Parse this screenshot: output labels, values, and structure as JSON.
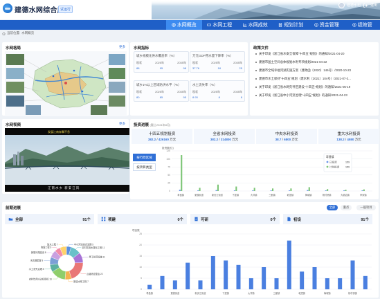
{
  "header": {
    "title": "建德水网综合应用",
    "trial_tag": "试运行",
    "user_name": "建德水利",
    "logout": "退出"
  },
  "nav": {
    "items": [
      {
        "label": "水网概览",
        "icon": "globe-icon",
        "active": true
      },
      {
        "label": "水网工程",
        "icon": "pipe-icon",
        "active": false
      },
      {
        "label": "水网成效",
        "icon": "chart-icon",
        "active": false
      },
      {
        "label": "规划计划",
        "icon": "doc-icon",
        "active": false
      },
      {
        "label": "资金管理",
        "icon": "money-icon",
        "active": false
      },
      {
        "label": "绩效管",
        "icon": "target-icon",
        "active": false
      }
    ]
  },
  "breadcrumb": {
    "prefix": "当前位置:",
    "current": "水网概览"
  },
  "water_map": {
    "title": "水网格局",
    "more": "更多"
  },
  "indicators": {
    "title": "水网指标",
    "cards": [
      {
        "name": "城乡规模化供水覆盖率（%）",
        "cols": [
          "现状",
          "2025年",
          "2035年"
        ],
        "vals": [
          "88",
          "95",
          "98"
        ]
      },
      {
        "name": "万元GDP用水量下降率（%）",
        "cols": [
          "现状",
          "2025年",
          "2035年"
        ],
        "vals": [
          "37.76",
          "18",
          "25"
        ]
      },
      {
        "name": "城乡1%以上区域防洪水平（%）",
        "cols": [
          "现状",
          "2025年",
          "2035年"
        ],
        "vals": [
          "80",
          "85",
          "95"
        ]
      },
      {
        "name": "水土流失率（%）",
        "cols": [
          "现状",
          "2025年",
          "2035年"
        ],
        "vals": [
          "8.93",
          "8",
          "8"
        ]
      }
    ]
  },
  "policy": {
    "title": "政策文件",
    "items": [
      "关于印发《浙江省水安全保障\"十四五\"规划》的通知/2021-04-20",
      "建德市国土空间总体规划水利专项规划/2021-04-22",
      "建德市全域幸福河湖实施方案（建政函〔2020〕146号）/2020-10-23",
      "建德市水土保持\"十四五\"规划（建水利〔2021〕104号）/2021-07-2...",
      "关于印发《浙江省水网先导区建设\"十四五\"规划》的通知/2021-05-19",
      "关于印发《浙江省中小河流治理\"十四五\"规划》的通知/2021-04-23"
    ]
  },
  "video": {
    "title": "水网视频",
    "more": "更多",
    "caption": "发展江南奔腾不息",
    "subtitle": "江南水乡 新安江风"
  },
  "investment": {
    "title": "投资进展",
    "note": "(截止2021年8月)",
    "cards": [
      {
        "name": "十四五规划投资",
        "done": "382.2",
        "total": "426160",
        "unit": "万元"
      },
      {
        "name": "全省水网投资",
        "done": "382.2",
        "total": "314800",
        "unit": "万元"
      },
      {
        "name": "中央水利投资",
        "done": "38.7",
        "total": "6800",
        "unit": "万元"
      },
      {
        "name": "重大水利投资",
        "done": "138.2",
        "total": "4580",
        "unit": "万元"
      }
    ],
    "buttons": [
      "按行政区域",
      "按项目类型"
    ]
  },
  "chart_data": [
    {
      "type": "bar",
      "ylabel": "投资额(亿)",
      "ylim": [
        0,
        125
      ],
      "yticks": [
        0,
        25,
        50,
        75,
        100,
        125
      ],
      "categories": [
        "寿昌镇",
        "更楼街道",
        "新安江街道",
        "下涯镇",
        "大洋镇",
        "三都镇",
        "乾潭镇",
        "梅城镇",
        "杨村桥镇",
        "大慈岩镇",
        "李家镇"
      ],
      "series": [
        {
          "name": "已投资",
          "color": "#6b95e8",
          "values": [
            4,
            2,
            3,
            2,
            2,
            2,
            2,
            3,
            2,
            2,
            2
          ]
        },
        {
          "name": "计划投资",
          "color": "#7cc576",
          "values": [
            112,
            10,
            20,
            14,
            10,
            8,
            8,
            12,
            6,
            4,
            5
          ]
        }
      ],
      "legend": {
        "title": "寿昌镇",
        "entries": [
          {
            "name": "已投资",
            "value": "159"
          },
          {
            "name": "计划投资",
            "value": "159"
          }
        ]
      }
    },
    {
      "type": "pie",
      "slices": [
        {
          "label": "中小河流综合治理",
          "value": 5,
          "color": "#5b8fe0"
        },
        {
          "label": "农村饮用水提标工程",
          "value": 11,
          "color": "#69c0c9"
        },
        {
          "label": "骨干排涝设施",
          "value": 11,
          "color": "#a772d6"
        },
        {
          "label": "山塘综合整治",
          "value": 22,
          "color": "#e97777"
        },
        {
          "label": "新建水库工程",
          "value": 7,
          "color": "#f4b350"
        },
        {
          "label": "农村饮用水达标提标",
          "value": 16,
          "color": "#8fce6b"
        },
        {
          "label": "水土流失治理",
          "value": 8,
          "color": "#5cb0a0"
        },
        {
          "label": "水资源配置",
          "value": 8,
          "color": "#7c9fd6"
        },
        {
          "label": "美丽河湖建设",
          "value": 8,
          "color": "#c9a0e0"
        },
        {
          "label": "海塘工程",
          "value": 6,
          "color": "#f28ba8"
        },
        {
          "label": "防水工程",
          "value": 7,
          "color": "#ffd36b"
        }
      ],
      "labels": [
        "中小河流综合治理 5",
        "农村饮用水提标工程 11",
        "骨干排涝设施 11",
        "山塘综合整治 22",
        "新建水库工程 7",
        "农村饮用水达标提标 16",
        "水土流失治理 8",
        "水资源配置 8",
        "美丽河湖建设 8",
        "海塘工程 6",
        "防水工程 7"
      ]
    },
    {
      "type": "bar",
      "ylabel": "项目数",
      "ylim": [
        0,
        25
      ],
      "yticks": [
        0,
        5,
        10,
        15,
        20,
        25
      ],
      "categories": [
        "寿昌镇",
        "",
        "更楼街道",
        "",
        "新安江街道",
        "",
        "下涯镇",
        "",
        "大洋镇",
        "",
        "三都镇",
        "",
        "乾潭镇",
        "",
        "梅城镇",
        "",
        "杨村桥镇",
        ""
      ],
      "series": [
        {
          "name": "项目数",
          "color": "#4a7fe0",
          "values": [
            2,
            6,
            4,
            12,
            4,
            15,
            13,
            11,
            5,
            10,
            5,
            22,
            8,
            10,
            5,
            5,
            13,
            6
          ]
        }
      ]
    }
  ],
  "projects": {
    "title": "前期进展",
    "tabs": [
      {
        "label": "全部",
        "active": true
      },
      {
        "label": "重点",
        "active": false
      },
      {
        "label": "一般项目",
        "active": false
      }
    ],
    "stats": [
      {
        "label": "全部",
        "count": "91个",
        "icon": "folder-icon"
      },
      {
        "label": "项建",
        "count": "0个",
        "icon": "grid-icon"
      },
      {
        "label": "可研",
        "count": "0个",
        "icon": "doc-check-icon"
      },
      {
        "label": "初设",
        "count": "91个",
        "icon": "file-icon"
      }
    ]
  }
}
